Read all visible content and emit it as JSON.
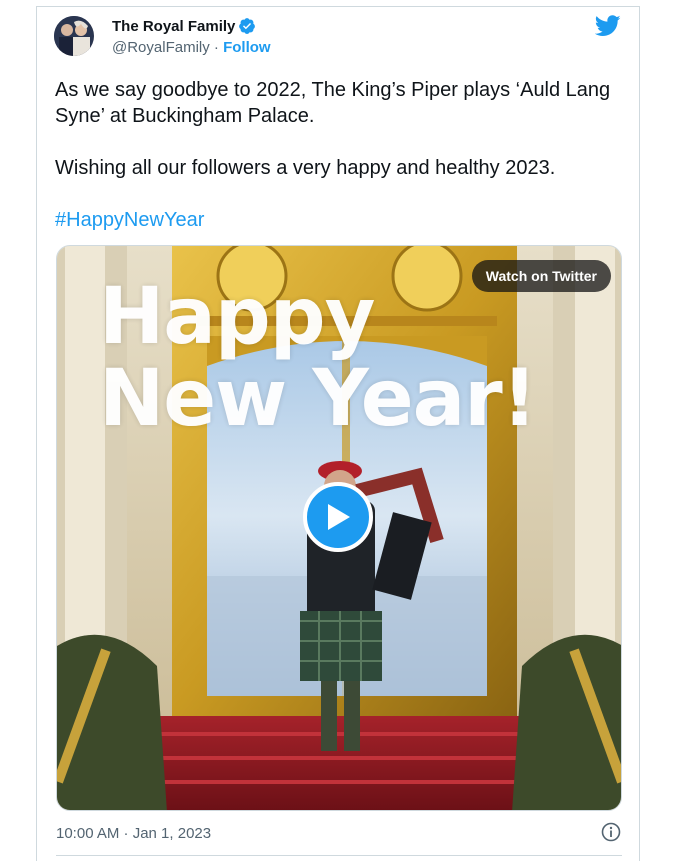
{
  "tweet": {
    "author_name": "The Royal Family",
    "handle": "@RoyalFamily",
    "separator": "·",
    "follow_label": "Follow",
    "text_line1": "As we say goodbye to 2022, The King’s Piper plays ‘Auld Lang Syne’ at Buckingham Palace.",
    "text_line2": "Wishing all our followers a very happy and healthy 2023.",
    "hashtag": "#HappyNewYear",
    "timestamp": "10:00 AM · Jan 1, 2023"
  },
  "media": {
    "watch_label": "Watch on Twitter",
    "overlay_line1": "Happy",
    "overlay_line2": "New Year!"
  },
  "icons": {
    "verified": "verified-badge-icon",
    "brand": "twitter-bird-icon",
    "play": "play-icon",
    "info": "info-icon"
  },
  "colors": {
    "accent": "#1d9bf0",
    "text": "#0f1419",
    "secondary": "#536471",
    "border": "#cfd9de"
  }
}
